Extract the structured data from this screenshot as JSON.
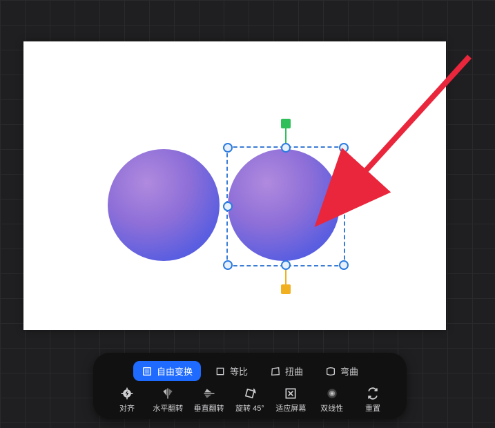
{
  "annotation": {
    "arrow": {
      "color": "#e9263b"
    }
  },
  "canvas": {
    "shapes": [
      {
        "type": "circle",
        "gradient": [
          "#b08ade",
          "#5a5ee0"
        ]
      },
      {
        "type": "circle",
        "gradient": [
          "#b08ade",
          "#5a5ee0"
        ],
        "selected": true
      }
    ],
    "selection": {
      "handle_color": "#2a7be0",
      "rotate_color": "#2fbf5a",
      "skew_color": "#f0b020"
    }
  },
  "toolbar": {
    "tabs": [
      {
        "id": "free",
        "label": "自由变换",
        "active": true
      },
      {
        "id": "constrain",
        "label": "等比",
        "active": false
      },
      {
        "id": "distort",
        "label": "扭曲",
        "active": false
      },
      {
        "id": "warp",
        "label": "弯曲",
        "active": false
      }
    ],
    "tools": [
      {
        "id": "align",
        "label": "对齐"
      },
      {
        "id": "flip-h",
        "label": "水平翻转"
      },
      {
        "id": "flip-v",
        "label": "垂直翻转"
      },
      {
        "id": "rotate45",
        "label": "旋转 45°"
      },
      {
        "id": "fit",
        "label": "适应屏幕"
      },
      {
        "id": "bilinear",
        "label": "双线性"
      },
      {
        "id": "reset",
        "label": "重置"
      }
    ]
  }
}
